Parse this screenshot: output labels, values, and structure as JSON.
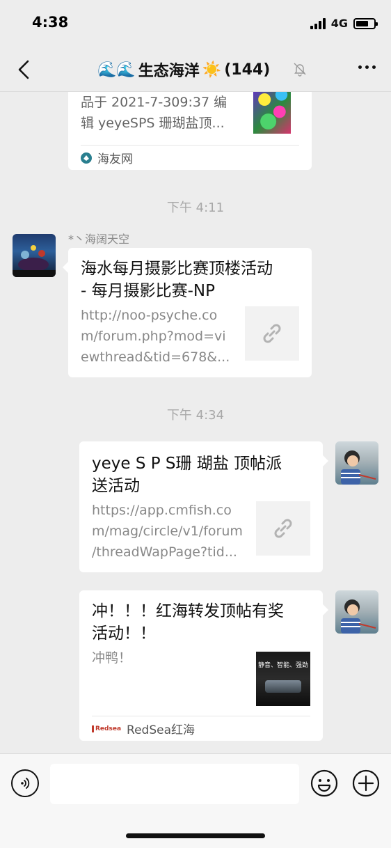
{
  "status": {
    "time": "4:38",
    "network": "4G"
  },
  "nav": {
    "wave_emoji": "🌊🌊",
    "title": "生态海洋",
    "sun_emoji": "☀️",
    "member_count": "(144)"
  },
  "messages": {
    "m1": {
      "desc_line1": "品于 2021-7-309:37 编",
      "desc_line2": "辑 yeyeSPS 珊瑚盐顶...",
      "source": "海友网"
    },
    "time1": "下午 4:11",
    "m2": {
      "sender": "*丶海阔天空",
      "title_line1": "海水每月摄影比赛顶楼活动",
      "title_line2": "- 每月摄影比赛-NP",
      "desc_line1": "http://noo-psyche.co",
      "desc_line2": "m/forum.php?mod=vi",
      "desc_line3": "ewthread&tid=678&..."
    },
    "time2": "下午 4:34",
    "m3": {
      "title_line1": "yeye S P S珊 瑚盐 顶帖派",
      "title_line2": "送活动",
      "desc_line1": "https://app.cmfish.co",
      "desc_line2": "m/mag/circle/v1/forum",
      "desc_line3": "/threadWapPage?tid..."
    },
    "m4": {
      "title_line1": "冲！！！红海转发顶帖有奖",
      "title_line2": "活动！！",
      "desc": "冲鸭！",
      "thumb_text": "静音、智能、强劲",
      "source": "RedSea红海",
      "source_logo": "Redsea"
    }
  },
  "input": {
    "placeholder": "",
    "value": ""
  },
  "colors": {
    "background": "#ededed",
    "card": "#ffffff",
    "muted": "#888888",
    "link_icon": "#b3b3b3"
  }
}
